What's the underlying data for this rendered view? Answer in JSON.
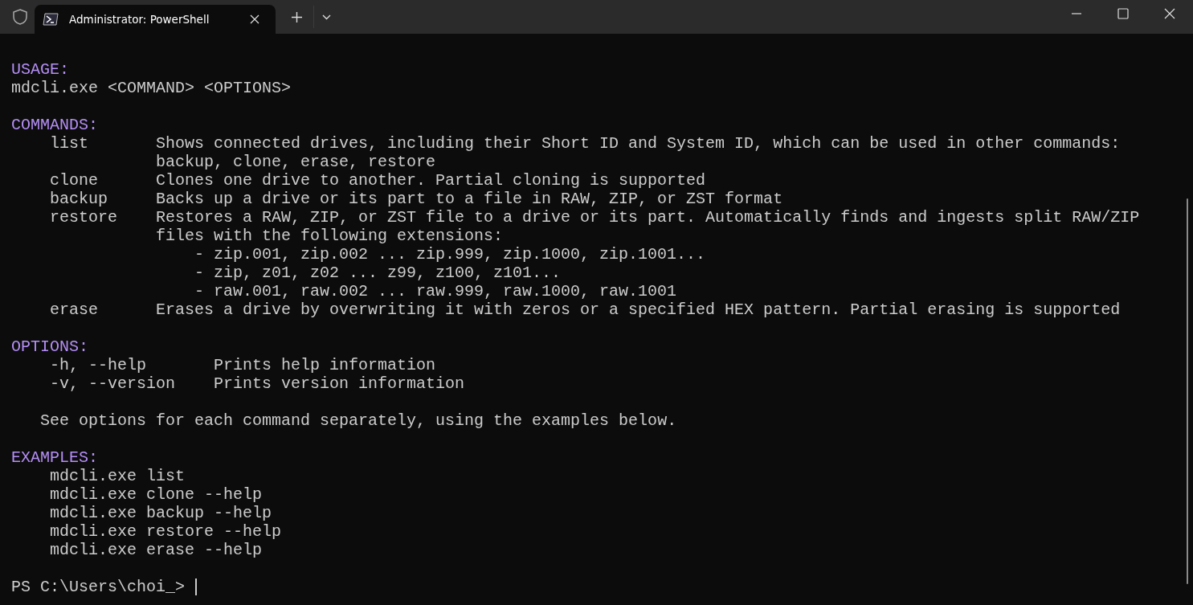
{
  "window": {
    "tab_title": "Administrator: PowerShell"
  },
  "terminal": {
    "sections": [
      {
        "heading": "USAGE:",
        "kind": "text",
        "lines": [
          "mdcli.exe <COMMAND> <OPTIONS>"
        ]
      },
      {
        "heading": "COMMANDS:",
        "kind": "table",
        "rows": [
          {
            "term": "list",
            "lines": [
              "Shows connected drives, including their Short ID and System ID, which can be used in other commands:",
              "backup, clone, erase, restore"
            ]
          },
          {
            "term": "clone",
            "lines": [
              "Clones one drive to another. Partial cloning is supported"
            ]
          },
          {
            "term": "backup",
            "lines": [
              "Backs up a drive or its part to a file in RAW, ZIP, or ZST format"
            ]
          },
          {
            "term": "restore",
            "lines": [
              "Restores a RAW, ZIP, or ZST file to a drive or its part. Automatically finds and ingests split RAW/ZIP",
              "files with the following extensions:"
            ],
            "children": [
              "- zip.001, zip.002 ... zip.999, zip.1000, zip.1001...",
              "- zip, z01, z02 ... z99, z100, z101...",
              "- raw.001, raw.002 ... raw.999, raw.1000, raw.1001"
            ]
          },
          {
            "term": "erase",
            "lines": [
              "Erases a drive by overwriting it with zeros or a specified HEX pattern. Partial erasing is supported"
            ]
          }
        ]
      },
      {
        "heading": "OPTIONS:",
        "kind": "table",
        "rows": [
          {
            "term": "-h, --help",
            "lines": [
              "Prints help information"
            ]
          },
          {
            "term": "-v, --version",
            "lines": [
              "Prints version information"
            ]
          }
        ],
        "note": "See options for each command separately, using the examples below."
      },
      {
        "heading": "EXAMPLES:",
        "kind": "list",
        "lines": [
          "mdcli.exe list",
          "mdcli.exe clone --help",
          "mdcli.exe backup --help",
          "mdcli.exe restore --help",
          "mdcli.exe erase --help"
        ]
      }
    ],
    "prompt": "PS C:\\Users\\choi_>"
  }
}
